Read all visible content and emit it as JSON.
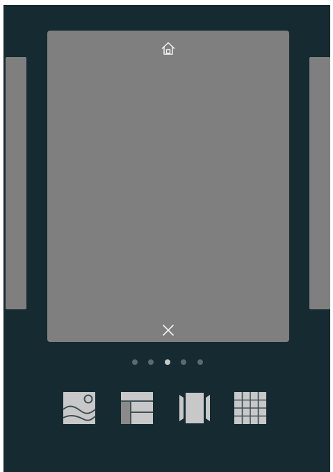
{
  "app": {
    "icons": {
      "home": "home-icon",
      "close": "close-icon",
      "wallpaper": "wallpaper-icon",
      "widgets": "widgets-icon",
      "transitions": "transition-icon",
      "grid": "grid-icon"
    },
    "colors": {
      "background": "#152a31",
      "page": "#7f7f7f",
      "icon": "#c8c8c8",
      "dot": "#5a6a6f",
      "dot_active": "#c7c7c7"
    },
    "pager": {
      "total_pages": 5,
      "current_page": 3
    }
  }
}
